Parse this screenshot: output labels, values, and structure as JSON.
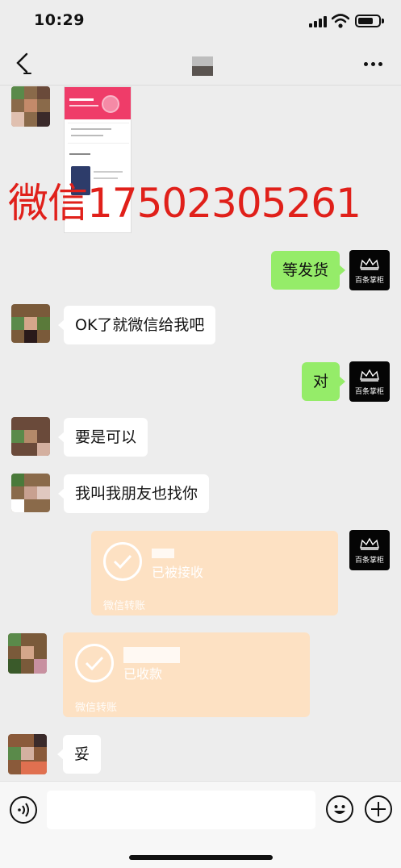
{
  "status_bar": {
    "time": "10:29"
  },
  "watermark": "微信17502305261",
  "brand": {
    "name": "百条掌柜"
  },
  "messages": {
    "m1": "等发货",
    "m2": "OK了就微信给我吧",
    "m3": "对",
    "m4": "要是可以",
    "m5": "我叫我朋友也找你",
    "m6": "妥"
  },
  "transfers": {
    "t1": {
      "status": "已被接收",
      "footer": "微信转账"
    },
    "t2": {
      "status": "已收款",
      "footer": "微信转账"
    }
  },
  "screenshot_card": {
    "title": "充值成功",
    "button_left": "查看订单",
    "button_right": "完成返回",
    "section": "猜你喜欢"
  },
  "icons": {
    "back": "back-arrow-icon",
    "more": "more-dots-icon",
    "voice": "voice-icon",
    "emoji": "emoji-icon",
    "plus": "plus-icon"
  },
  "colors": {
    "green_bubble": "#95ec69",
    "transfer_bg": "#fde1c3",
    "watermark": "#e0201a"
  }
}
